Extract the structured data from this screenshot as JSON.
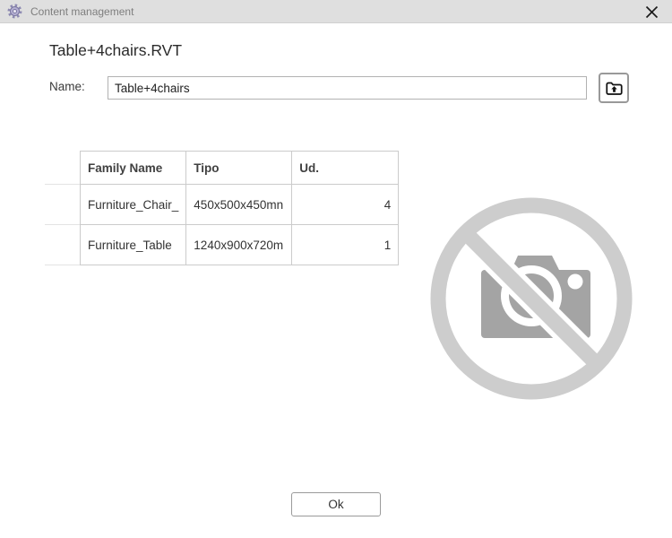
{
  "window": {
    "title": "Content management"
  },
  "header": {
    "title": "Table+4chairs.RVT"
  },
  "name_field": {
    "label": "Name:",
    "value": "Table+4chairs"
  },
  "table": {
    "columns": [
      "Family Name",
      "Tipo",
      "Ud."
    ],
    "rows": [
      {
        "family_name": "Furniture_Chair_",
        "tipo": "450x500x450mn",
        "ud": "4"
      },
      {
        "family_name": "Furniture_Table",
        "tipo": "1240x900x720m",
        "ud": "1"
      }
    ]
  },
  "footer": {
    "ok_label": "Ok"
  },
  "icons": {
    "titlebar_icon": "gear-icon",
    "name_button_icon": "folder-upload-icon",
    "placeholder_icon": "no-image-camera-icon",
    "close_icon": "close-icon"
  },
  "colors": {
    "titlebar_bg": "#dfdfdf",
    "titlebar_text": "#7e7e7e",
    "grid_border": "#cbcbcb",
    "gutter_border": "#e3e3e3",
    "placeholder_light_gray": "#cdcdcd",
    "placeholder_camera_gray": "#a4a4a4",
    "gear_purple": "#aaa5cc",
    "icon_black": "#111111"
  }
}
